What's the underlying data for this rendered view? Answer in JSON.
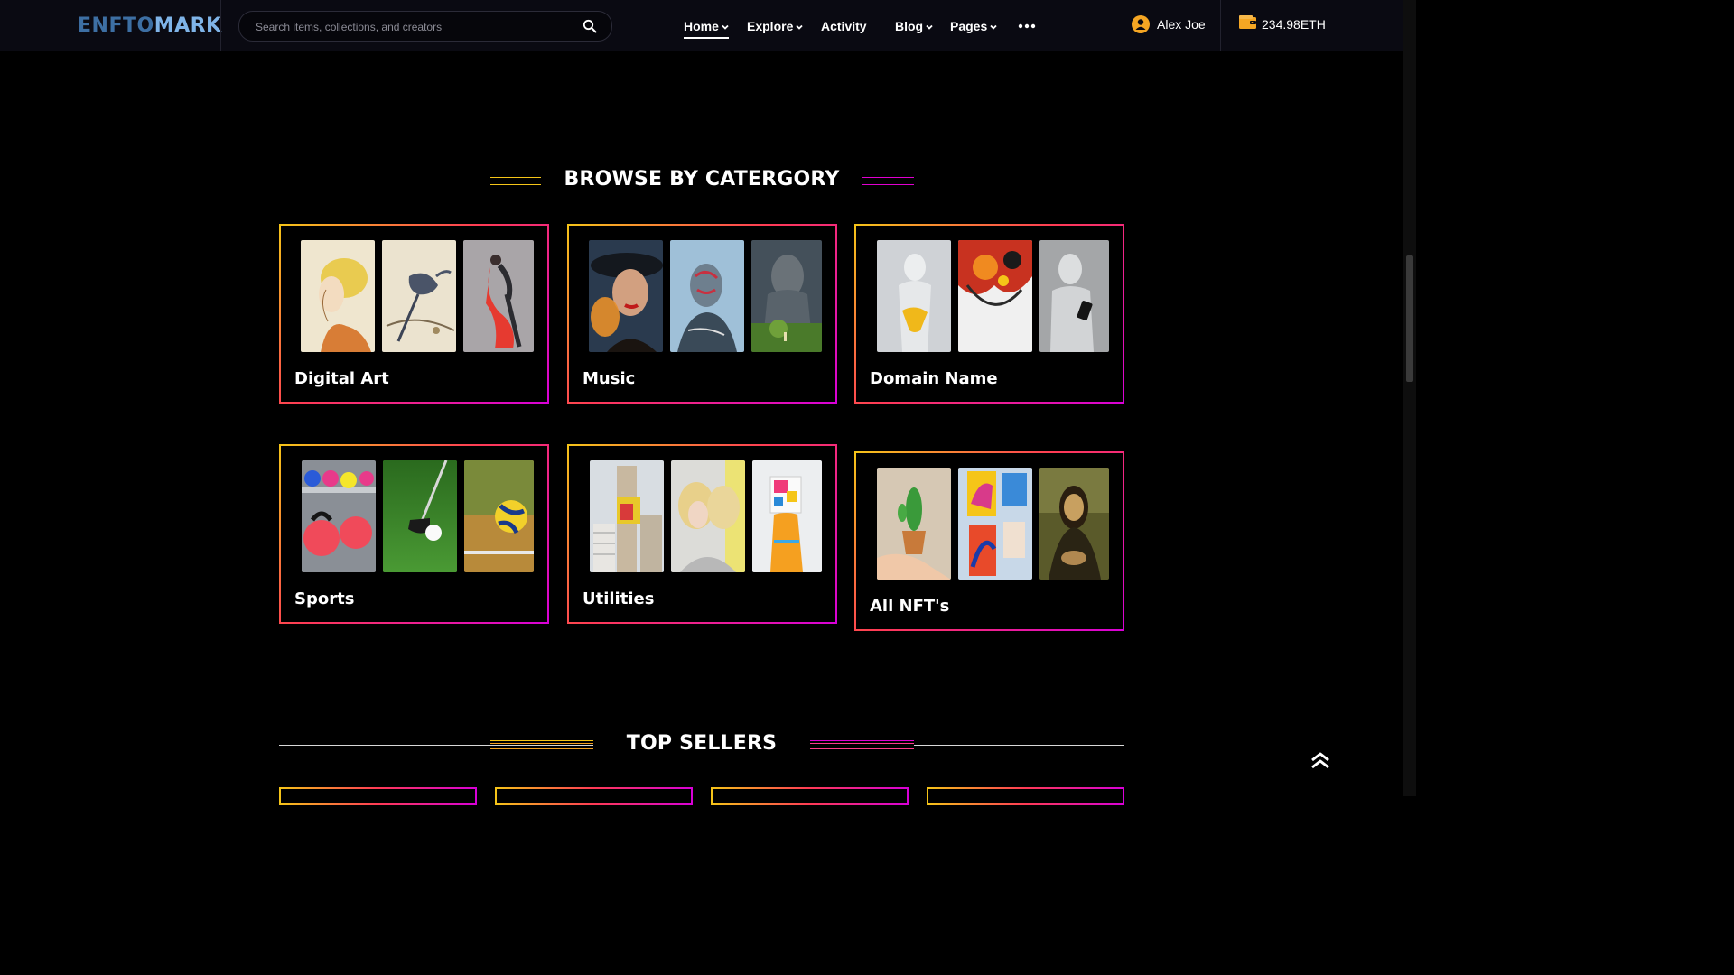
{
  "header": {
    "logo_part1": "ENFTO",
    "logo_part2": "MARK",
    "search_placeholder": "Search items, collections, and creators",
    "nav": [
      {
        "label": "Home",
        "has_dropdown": true,
        "active": true
      },
      {
        "label": "Explore",
        "has_dropdown": true,
        "active": false
      },
      {
        "label": "Activity",
        "has_dropdown": false,
        "active": false
      },
      {
        "label": "Blog",
        "has_dropdown": true,
        "active": false
      },
      {
        "label": "Pages",
        "has_dropdown": true,
        "active": false
      }
    ],
    "more_icon": "more-dots-icon",
    "user_name": "Alex Joe",
    "user_icon": "user-avatar-icon",
    "wallet_balance": "234.98ETH",
    "wallet_icon": "wallet-icon"
  },
  "browse": {
    "title": "BROWSE BY CATERGORY",
    "categories": [
      {
        "label": "Digital Art",
        "images": [
          "watercolor-woman-portrait",
          "bird-on-branch-sketch",
          "tango-dancers-painting"
        ]
      },
      {
        "label": "Music",
        "images": [
          "woman-with-hat-portrait",
          "graffiti-head-figure",
          "giant-statue-forest"
        ]
      },
      {
        "label": "Domain Name",
        "images": [
          "white-statue-yellow-paint",
          "abstract-paint-splash",
          "statue-with-phone"
        ]
      },
      {
        "label": "Sports",
        "images": [
          "kettlebells-rack",
          "golf-club-ball",
          "volleyball-court"
        ]
      },
      {
        "label": "Utilities",
        "images": [
          "city-building-billboard",
          "blonde-woman-mirror",
          "woman-holding-painting"
        ]
      },
      {
        "label": "All NFT's",
        "images": [
          "hand-holding-cactus",
          "colorful-horse-paintings",
          "mona-lisa"
        ]
      }
    ]
  },
  "top_sellers": {
    "title": "TOP SELLERS"
  },
  "colors": {
    "background": "#000000",
    "header_bg": "#0a0a12",
    "gradient_start": "#f5c518",
    "gradient_mid": "#ff3a55",
    "gradient_end": "#d800d8",
    "logo_dark": "#3d6fa3",
    "logo_light": "#7fb4e8",
    "wallet_orange": "#f5a623"
  },
  "back_to_top_icon": "double-chevron-up-icon"
}
